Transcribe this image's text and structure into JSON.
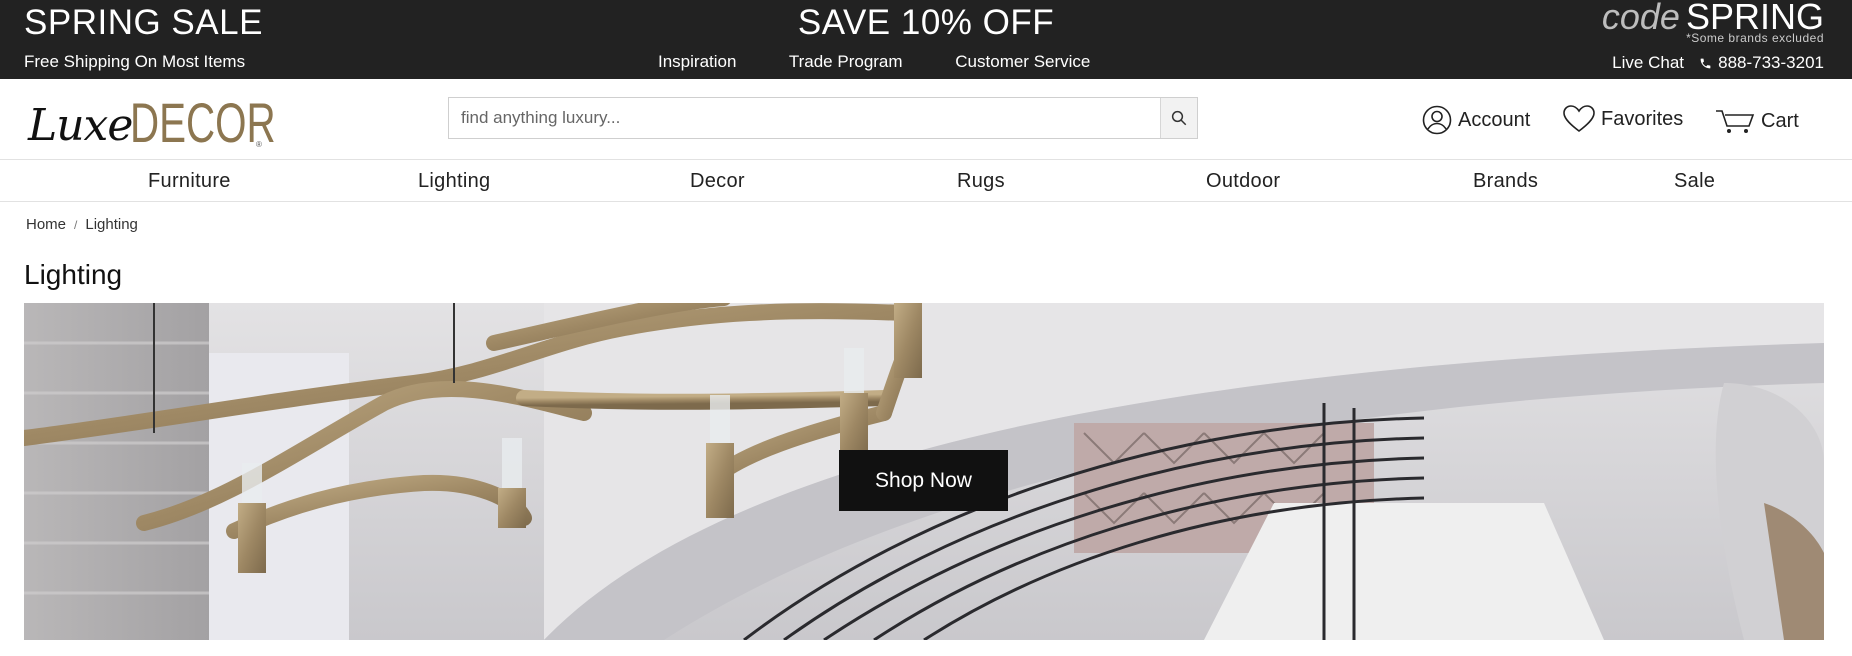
{
  "promo": {
    "sale_title": "SPRING SALE",
    "free_shipping": "Free Shipping On Most Items",
    "save_text": "SAVE 10% OFF",
    "code_label": "code",
    "code_value": "SPRING",
    "excluded_note": "*Some brands excluded",
    "links": [
      "Inspiration",
      "Trade Program",
      "Customer Service"
    ],
    "live_chat": "Live Chat",
    "phone": "888-733-3201"
  },
  "header": {
    "logo_script": "Luxe",
    "logo_caps": "DECOR",
    "search_placeholder": "find anything luxury...",
    "account_label": "Account",
    "favorites_label": "Favorites",
    "cart_label": "Cart"
  },
  "nav": [
    "Furniture",
    "Lighting",
    "Decor",
    "Rugs",
    "Outdoor",
    "Brands",
    "Sale"
  ],
  "breadcrumb": {
    "home": "Home",
    "separator": "/",
    "current": "Lighting"
  },
  "page_title": "Lighting",
  "hero": {
    "button_label": "Shop Now"
  },
  "colors": {
    "promo_bg": "#222222",
    "brand_gold": "#8c7650",
    "button_bg": "#111111"
  }
}
